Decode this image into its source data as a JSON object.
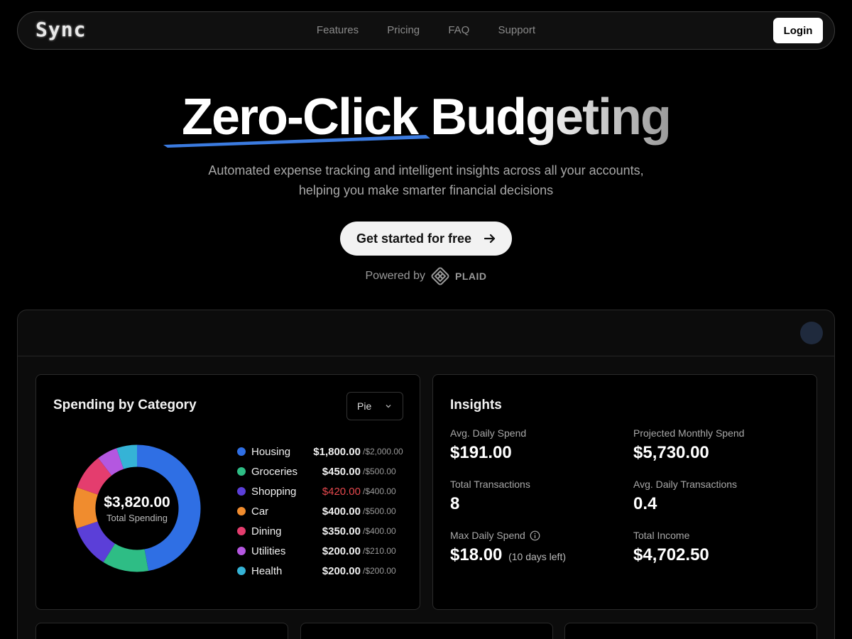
{
  "nav": {
    "logo": "Sync",
    "links": [
      "Features",
      "Pricing",
      "FAQ",
      "Support"
    ],
    "login": "Login"
  },
  "hero": {
    "title_part1": "Zero-Click",
    "title_part2": "Budgeting",
    "subtitle_line1": "Automated expense tracking and intelligent insights across all your accounts,",
    "subtitle_line2": "helping you make smarter financial decisions",
    "cta": "Get started for free",
    "powered_by": "Powered by",
    "partner": "PLAID"
  },
  "spending": {
    "title": "Spending by Category",
    "chart_type_selected": "Pie",
    "total": "$3,820.00",
    "total_label": "Total Spending",
    "categories": [
      {
        "name": "Housing",
        "spent": "$1,800.00",
        "budget": "/$2,000.00",
        "amount": 1800,
        "color": "#2f6fe4",
        "over": false
      },
      {
        "name": "Groceries",
        "spent": "$450.00",
        "budget": "/$500.00",
        "amount": 450,
        "color": "#2ebd85",
        "over": false
      },
      {
        "name": "Shopping",
        "spent": "$420.00",
        "budget": "/$400.00",
        "amount": 420,
        "color": "#5b3fd8",
        "over": true
      },
      {
        "name": "Car",
        "spent": "$400.00",
        "budget": "/$500.00",
        "amount": 400,
        "color": "#f08c2e",
        "over": false
      },
      {
        "name": "Dining",
        "spent": "$350.00",
        "budget": "/$400.00",
        "amount": 350,
        "color": "#e43d6e",
        "over": false
      },
      {
        "name": "Utilities",
        "spent": "$200.00",
        "budget": "/$210.00",
        "amount": 200,
        "color": "#b457e0",
        "over": false
      },
      {
        "name": "Health",
        "spent": "$200.00",
        "budget": "/$200.00",
        "amount": 200,
        "color": "#35b3d6",
        "over": false
      }
    ]
  },
  "insights": {
    "title": "Insights",
    "avg_daily_spend_label": "Avg. Daily Spend",
    "avg_daily_spend": "$191.00",
    "projected_label": "Projected Monthly Spend",
    "projected": "$5,730.00",
    "total_tx_label": "Total Transactions",
    "total_tx": "8",
    "avg_daily_tx_label": "Avg. Daily Transactions",
    "avg_daily_tx": "0.4",
    "max_daily_label": "Max Daily Spend",
    "max_daily": "$18.00",
    "days_left": "(10 days left)",
    "income_label": "Total Income",
    "income": "$4,702.50"
  },
  "colors": {
    "accent_underline": "#3b7be0",
    "over_budget": "#e5484d"
  }
}
